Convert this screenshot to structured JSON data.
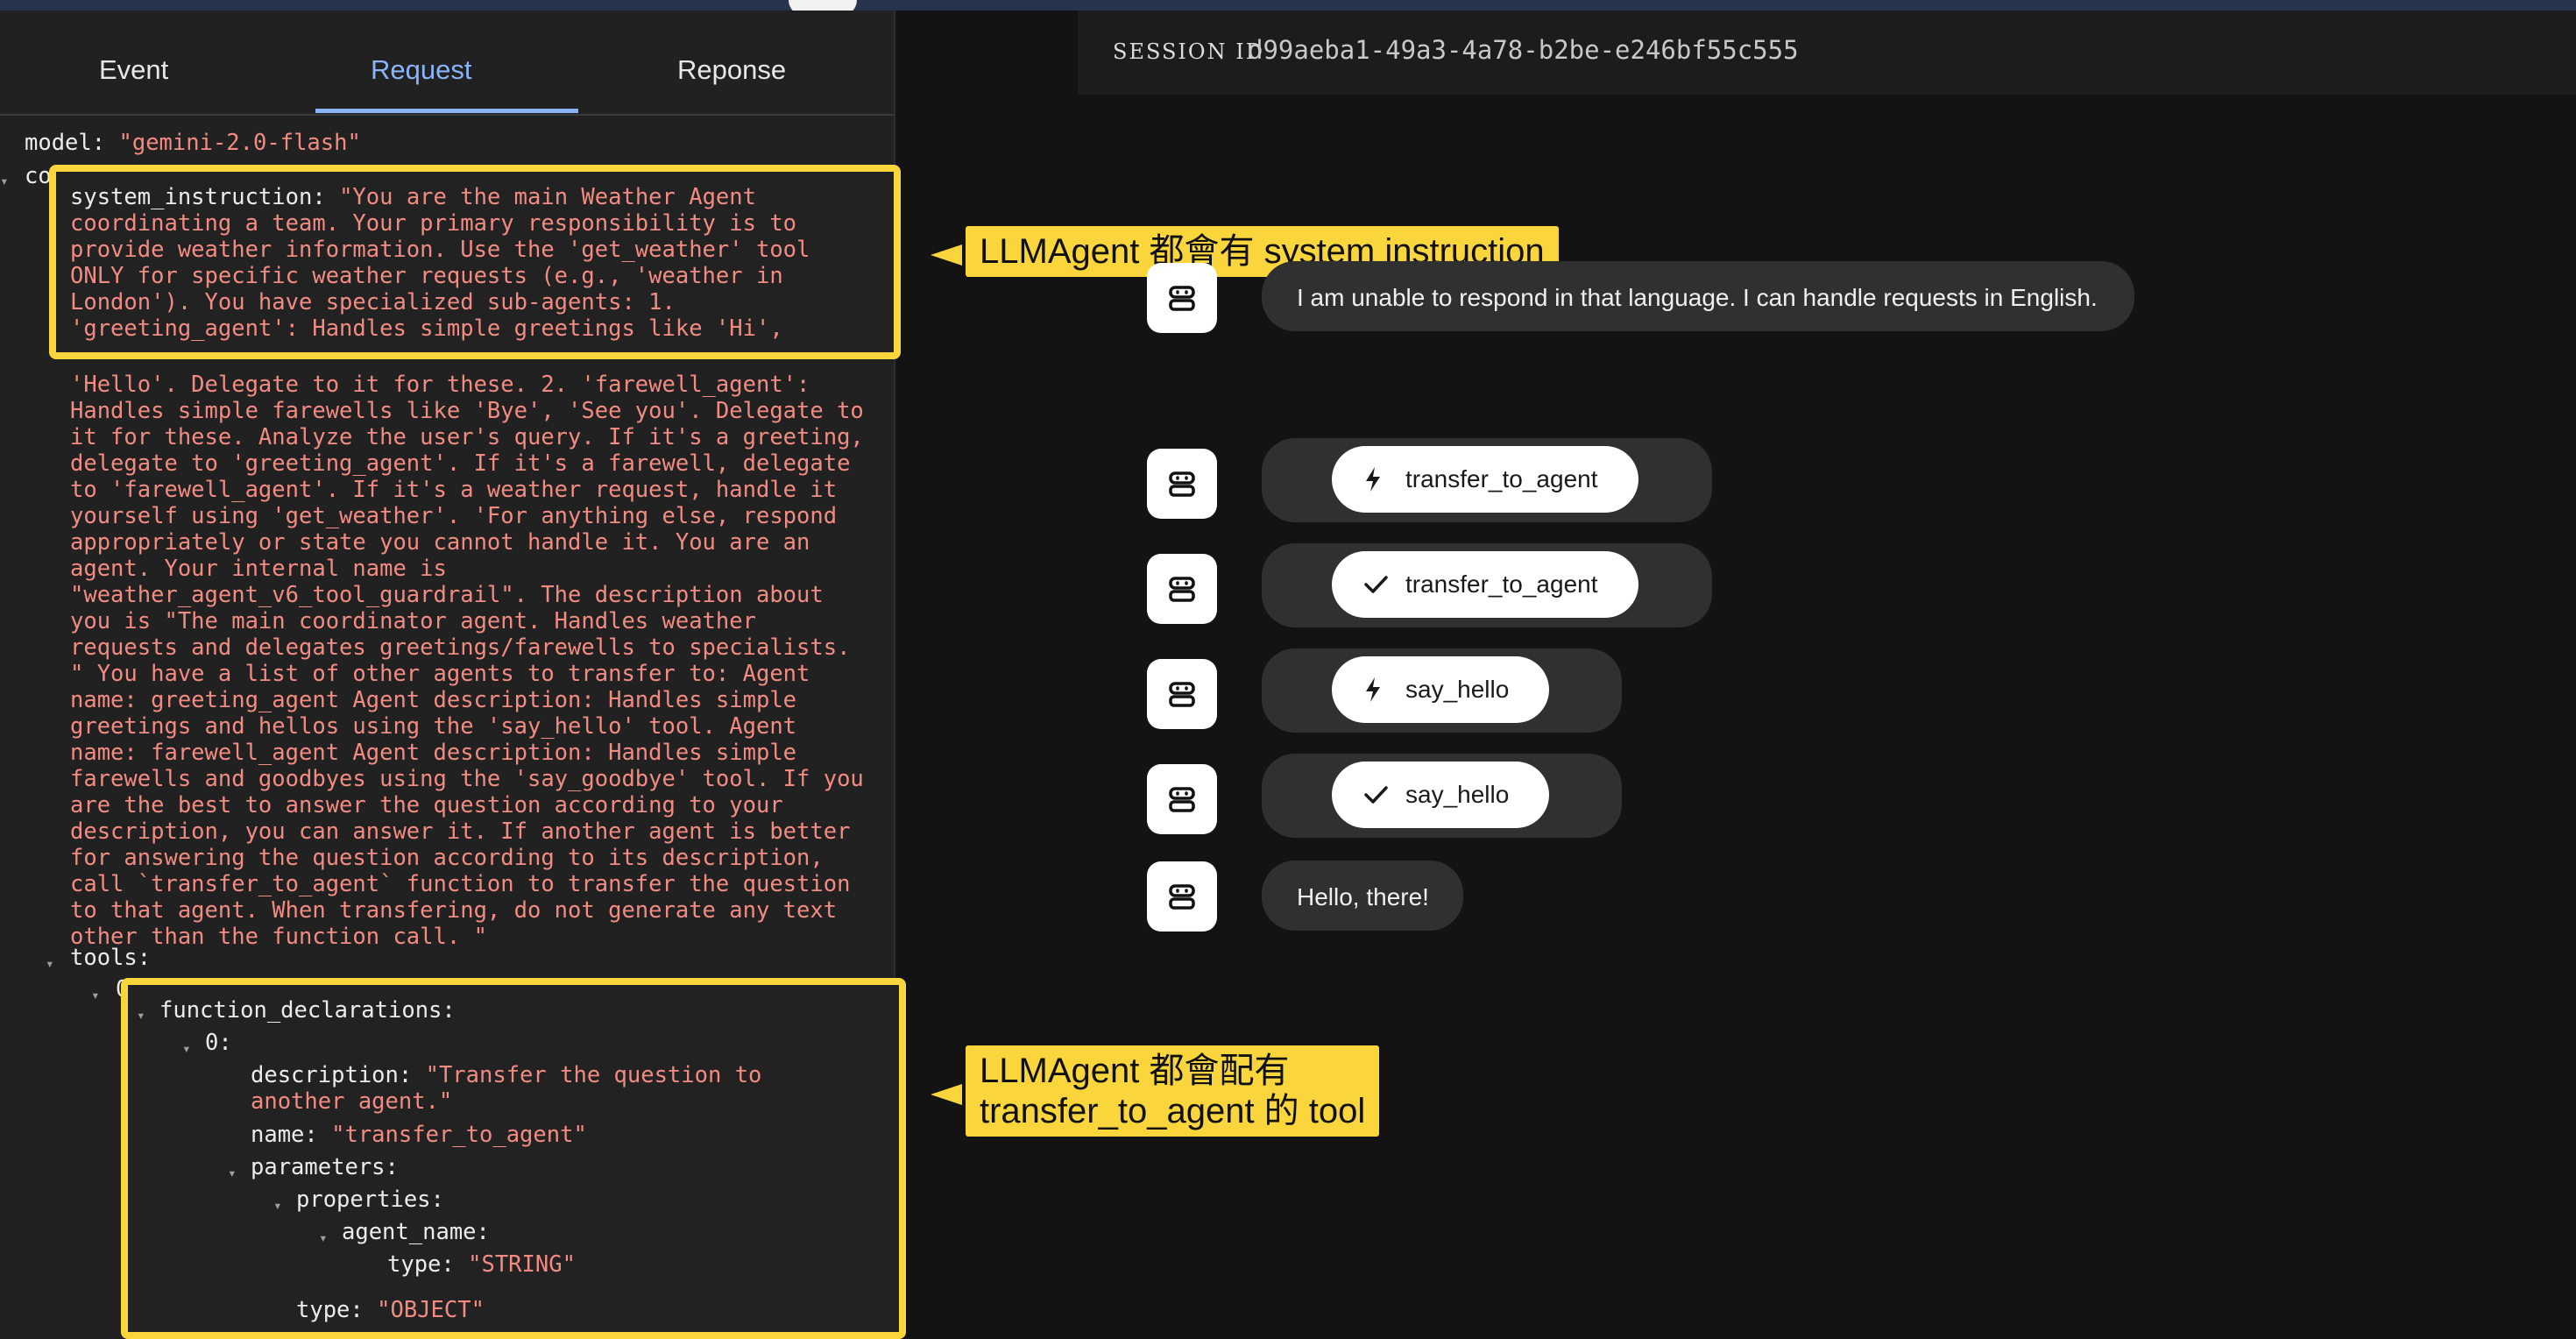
{
  "tabs": [
    "Event",
    "Request",
    "Reponse"
  ],
  "request": {
    "model_key": "model:",
    "model_value": "\"gemini-2.0-flash\"",
    "config_key": "config:",
    "system_key": "system_instruction:",
    "system_lines": [
      "\"You are the main Weather Agent",
      "coordinating a team. Your primary responsibility is to",
      "provide weather information. Use the 'get_weather' tool",
      "ONLY for specific weather requests (e.g., 'weather in",
      "London'). You have specialized sub-agents: 1.",
      "'greeting_agent': Handles simple greetings like 'Hi',",
      "'Hello'. Delegate to it for these. 2. 'farewell_agent':",
      "Handles simple farewells like 'Bye', 'See you'. Delegate to",
      "it for these. Analyze the user's query. If it's a greeting,",
      "delegate to 'greeting_agent'. If it's a farewell, delegate",
      "to 'farewell_agent'. If it's a weather request, handle it",
      "yourself using 'get_weather'. 'For anything else, respond",
      "appropriately or state you cannot handle it. You are an",
      "agent. Your internal name is",
      "\"weather_agent_v6_tool_guardrail\". The description about",
      "you is \"The main coordinator agent. Handles weather",
      "requests and delegates greetings/farewells to specialists.",
      "\" You have a list of other agents to transfer to: Agent",
      "name: greeting_agent Agent description: Handles simple",
      "greetings and hellos using the 'say_hello' tool. Agent",
      "name: farewell_agent Agent description: Handles simple",
      "farewells and goodbyes using the 'say_goodbye' tool. If you",
      "are the best to answer the question according to your",
      "description, you can answer it. If another agent is better",
      "for answering the question according to its description,",
      "call `transfer_to_agent` function to transfer the question",
      "to that agent. When transfering, do not generate any text",
      "other than the function call. \""
    ],
    "tools_key": "tools:",
    "index0": "0:",
    "function_declarations_key": "function_declarations:",
    "fd_index0": "0:",
    "description_key": "description:",
    "description_lines": [
      "\"Transfer the question to",
      "another agent.\""
    ],
    "name_key": "name:",
    "name_value": "\"transfer_to_agent\"",
    "parameters_key": "parameters:",
    "properties_key": "properties:",
    "agent_name_key": "agent_name:",
    "type_key": "type:",
    "type_string": "\"STRING\"",
    "type_object": "\"OBJECT\""
  },
  "session": {
    "label": "SESSION ID",
    "id": "d99aeba1-49a3-4a78-b2be-e246bf55c555"
  },
  "messages": {
    "top_text": "I am unable to respond in that language. I can handle requests in English.",
    "chips": [
      {
        "icon": "bolt-icon",
        "label": "transfer_to_agent"
      },
      {
        "icon": "check-icon",
        "label": "transfer_to_agent"
      },
      {
        "icon": "bolt-icon",
        "label": "say_hello"
      },
      {
        "icon": "check-icon",
        "label": "say_hello"
      }
    ],
    "final_text": "Hello, there!"
  },
  "annotations": {
    "callout1": "LLMAgent 都會有 system instruction",
    "callout2_line1": "LLMAgent 都會配有",
    "callout2_line2": "transfer_to_agent 的 tool"
  },
  "colors": {
    "accent_tab": "#8ab4f8",
    "highlight": "#fad53c",
    "string_value": "#f28b82"
  }
}
